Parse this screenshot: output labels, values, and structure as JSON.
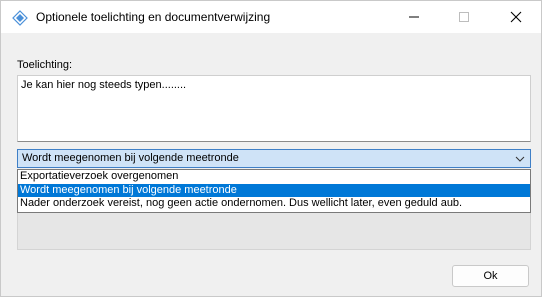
{
  "window": {
    "title": "Optionele toelichting en documentverwijzing",
    "controls": {
      "minimize_icon": "minimize-icon",
      "maximize_icon": "maximize-icon",
      "close_icon": "close-icon"
    }
  },
  "form": {
    "toelichting_label": "Toelichting:",
    "toelichting_value": "Je kan hier nog steeds typen........",
    "combo_selected": "Wordt meegenomen bij volgende meetronde",
    "dropdown_options": [
      "Exportatieverzoek overgenomen",
      "Wordt meegenomen bij volgende meetronde",
      "Nader onderzoek vereist, nog geen actie ondernomen. Dus wellicht later, even geduld aub."
    ],
    "selected_index": 1,
    "ok_label": "Ok"
  },
  "colors": {
    "selection": "#0078d7",
    "combo_background": "#cfe3f7",
    "combo_border": "#3f7fc6",
    "app_icon": "#4a90d9"
  }
}
